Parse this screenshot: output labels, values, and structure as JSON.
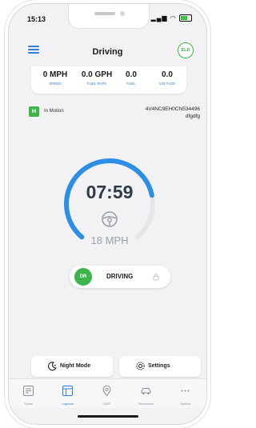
{
  "status_bar": {
    "time": "15:13"
  },
  "app_bar": {
    "title": "Driving",
    "eld_badge": "ELD"
  },
  "metrics": [
    {
      "value": "0 MPH",
      "label": "SPEED"
    },
    {
      "value": "0.0 GPH",
      "label": "FUEL RATE"
    },
    {
      "value": "0.0",
      "label": "FUEL"
    },
    {
      "value": "0.0",
      "label": "VOLTAGE"
    }
  ],
  "motion": {
    "badge": "M",
    "status_text": "In Motion",
    "vin": "4V4NC9EH0CN534496",
    "vehicle_name": "dfgdfg"
  },
  "gauge": {
    "clock": "07:59",
    "speed": "18 MPH",
    "fraction": 0.78,
    "color": "#2d8ee6"
  },
  "duty_status": {
    "badge": "DR",
    "label": "DRIVING"
  },
  "buttons": {
    "night_mode": "Night Mode",
    "settings": "Settings"
  },
  "tabs": [
    {
      "label": "Social",
      "icon": "social-icon",
      "active": false
    },
    {
      "label": "Logbook",
      "icon": "logbook-icon",
      "active": true
    },
    {
      "label": "DVIR",
      "icon": "location-pin-icon",
      "active": false
    },
    {
      "label": "Documents",
      "icon": "car-icon",
      "active": false
    },
    {
      "label": "Options",
      "icon": "more-icon",
      "active": false
    }
  ],
  "colors": {
    "accent": "#2d7fd8",
    "green": "#3cb54a"
  }
}
